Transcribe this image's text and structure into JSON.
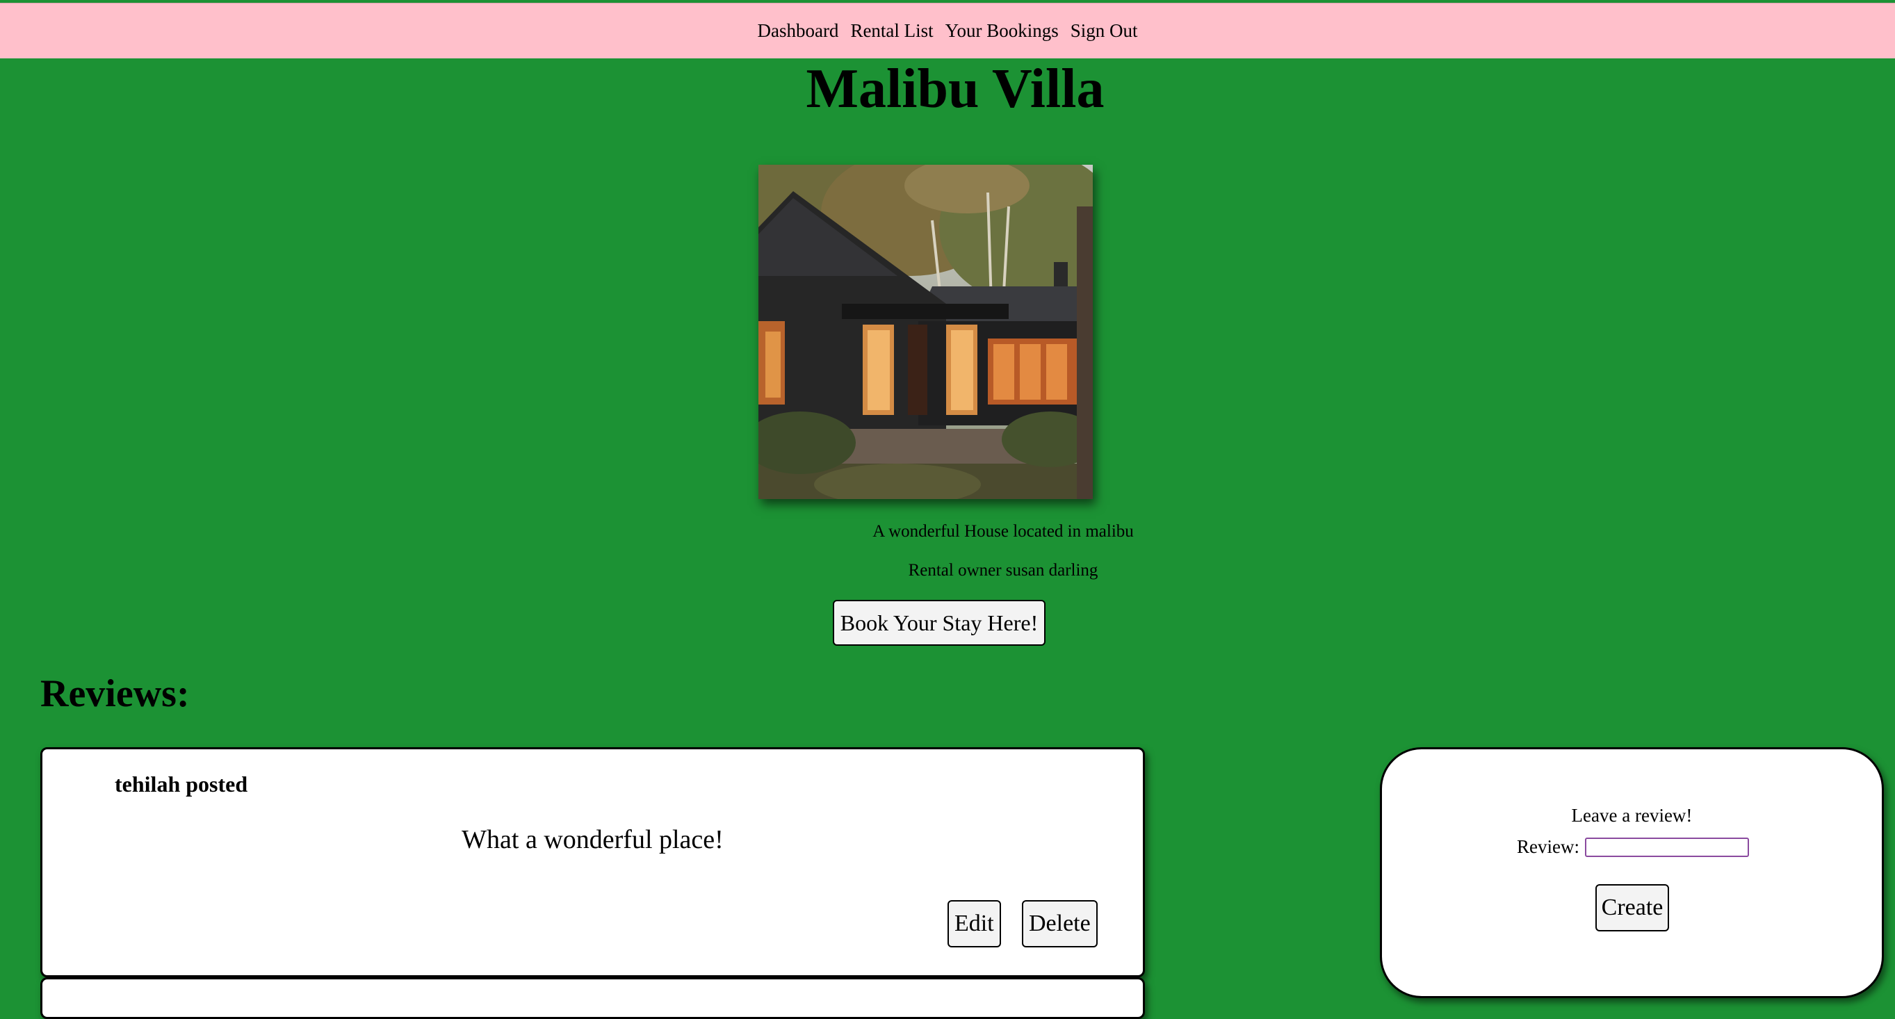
{
  "nav": {
    "items": [
      {
        "label": "Dashboard"
      },
      {
        "label": "Rental List"
      },
      {
        "label": "Your Bookings"
      },
      {
        "label": "Sign Out"
      }
    ]
  },
  "rental": {
    "title": "Malibu Villa",
    "description": "A wonderful House located in malibu",
    "owner_line": "Rental owner susan darling",
    "book_label": "Book Your Stay Here!"
  },
  "reviews": {
    "heading": "Reviews:",
    "items": [
      {
        "author_line": "tehilah posted",
        "text": "What a wonderful place!",
        "edit_label": "Edit",
        "delete_label": "Delete"
      }
    ]
  },
  "review_form": {
    "title": "Leave a review!",
    "field_label": "Review:",
    "field_value": "",
    "submit_label": "Create"
  },
  "colors": {
    "page_background": "#1c9234",
    "nav_background": "#ffc0cb",
    "input_border": "#8a4a9f"
  }
}
